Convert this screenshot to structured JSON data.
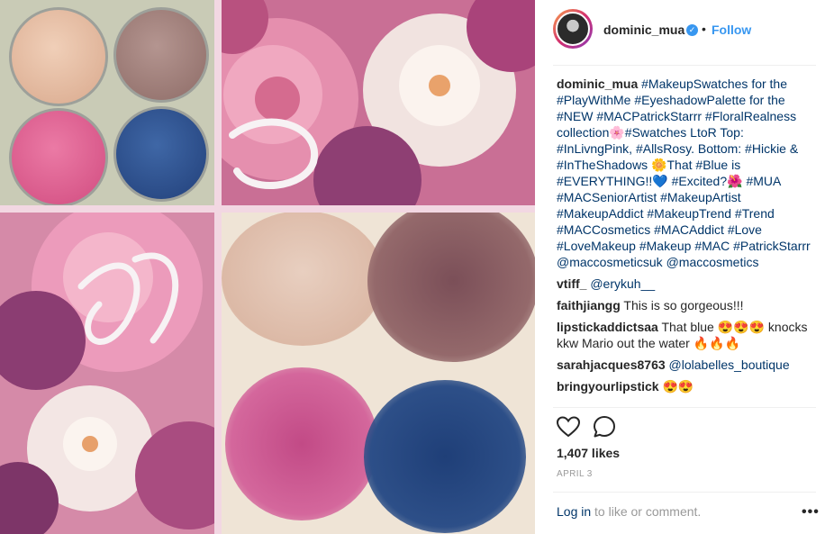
{
  "post": {
    "username": "dominic_mua",
    "verified_mark": "✓",
    "separator": "•",
    "follow_label": "Follow"
  },
  "caption": {
    "username": "dominic_mua",
    "text": "#MakeupSwatches for the #PlayWithMe #EyeshadowPalette for the #NEW #MACPatrickStarrr #FloralRealness collection🌸#Swatches LtoR Top: #InLivngPink, #AllsRosy. Bottom: #Hickie & #InTheShadows 🌼That #Blue is #EVERYTHING!!💙 #Excited?🌺 #MUA #MACSeniorArtist #MakeupArtist #MakeupAddict #MakeupTrend #Trend #MACCosmetics #MACAddict #Love #LoveMakeup #Makeup #MAC #PatrickStarrr @maccosmeticsuk @maccosmetics"
  },
  "comments": [
    {
      "user": "vtiff_",
      "text": "@erykuh__"
    },
    {
      "user": "faithjiangg",
      "text": "This is so gorgeous!!!"
    },
    {
      "user": "lipstickaddictsaa",
      "text": "That blue 😍😍😍 knocks kkw Mario out the water 🔥🔥🔥"
    },
    {
      "user": "sarahjacques8763",
      "text": "@lolabelles_boutique"
    },
    {
      "user": "bringyourlipstick",
      "text": "😍😍"
    }
  ],
  "actions": {
    "like_icon": "heart-icon",
    "comment_icon": "comment-icon"
  },
  "likes_text": "1,407 likes",
  "date_text": "APRIL 3",
  "footer": {
    "login_label": "Log in",
    "login_suffix": " to like or comment.",
    "more_label": "•••"
  },
  "colors": {
    "accent": "#3897f0",
    "hashtag": "#003569",
    "swatch_peach": "#e3b9a0",
    "swatch_taupe": "#9c7b77",
    "swatch_pink": "#dd5b8e",
    "swatch_blue": "#2d4e87"
  }
}
